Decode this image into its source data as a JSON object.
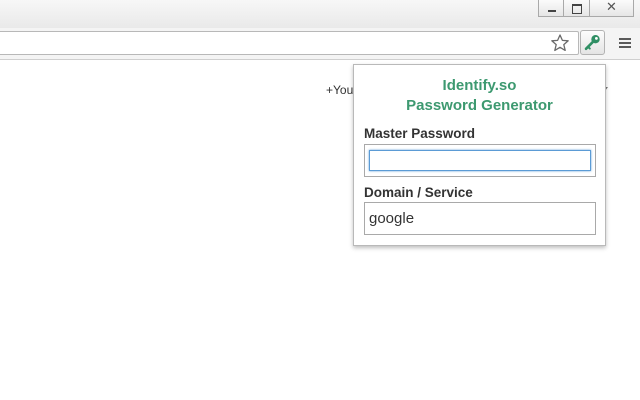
{
  "window": {
    "controls": {
      "close_glyph": "✕"
    }
  },
  "page": {
    "link_partial": "+You"
  },
  "popup": {
    "title_line1": "Identify.so",
    "title_line2": "Password Generator",
    "title_color": "#3d9970",
    "master_password": {
      "label": "Master Password",
      "value": "",
      "placeholder": ""
    },
    "domain": {
      "label": "Domain / Service",
      "value": "google"
    }
  },
  "icons": {
    "bookmark": "star-icon",
    "extension": "key-icon",
    "menu": "hamburger-menu-icon"
  }
}
